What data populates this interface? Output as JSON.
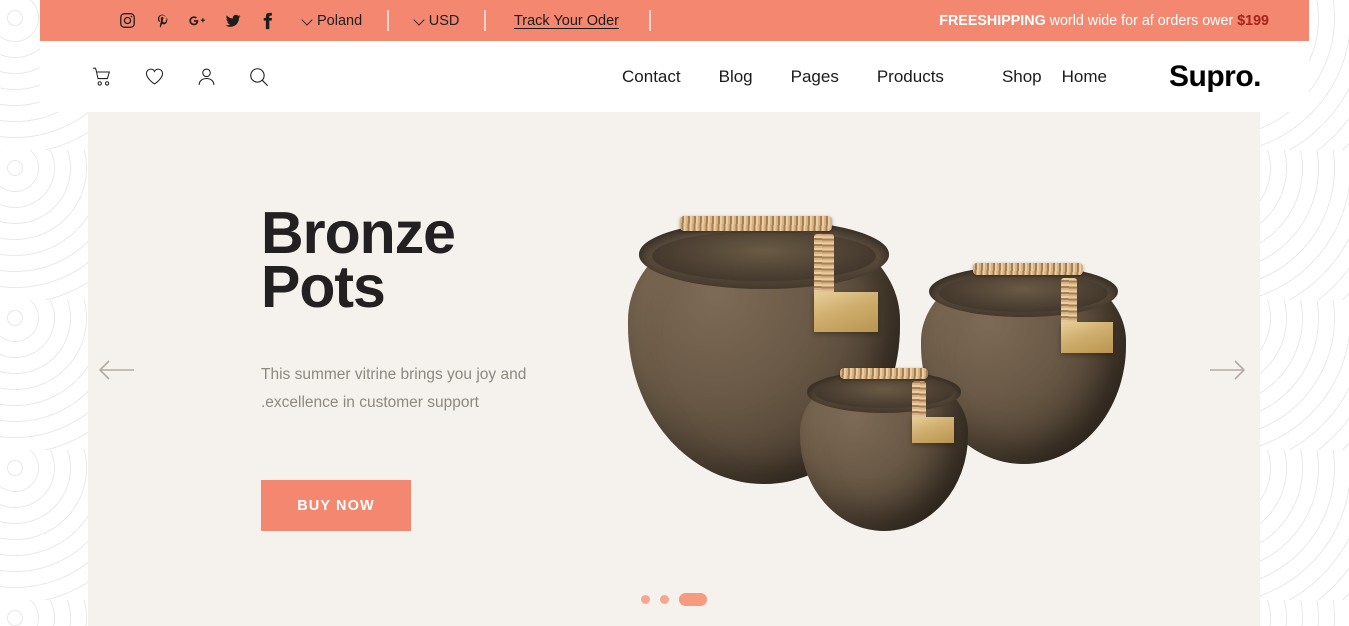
{
  "topbar": {
    "social": [
      {
        "name": "instagram-icon",
        "label": "Instagram"
      },
      {
        "name": "pinterest-icon",
        "label": "Pinterest"
      },
      {
        "name": "google-plus-icon",
        "label": "Google Plus"
      },
      {
        "name": "twitter-icon",
        "label": "Twitter"
      },
      {
        "name": "facebook-icon",
        "label": "Facebook"
      }
    ],
    "country": "Poland",
    "currency": "USD",
    "track_order": "Track Your Oder",
    "promo_prefix": "FREESHIPPING",
    "promo_text": " world wide for af orders ower ",
    "promo_price": "$199",
    "bg_color": "#F4876F",
    "promo_price_color": "#A5251A"
  },
  "header": {
    "icons": [
      {
        "name": "cart-icon",
        "label": "Cart"
      },
      {
        "name": "heart-icon",
        "label": "Wishlist"
      },
      {
        "name": "user-icon",
        "label": "Account"
      },
      {
        "name": "search-icon",
        "label": "Search"
      }
    ],
    "nav": [
      {
        "label": "Contact"
      },
      {
        "label": "Blog"
      },
      {
        "label": "Pages"
      },
      {
        "label": "Products"
      },
      {
        "label": "Shop"
      },
      {
        "label": "Home"
      }
    ],
    "brand": "Supro."
  },
  "hero": {
    "title_line1": "Bronze",
    "title_line2": "Pots",
    "subtitle_line1": "This summer vitrine brings you joy and",
    "subtitle_line2": ".excellence in customer support",
    "cta": "BUY NOW",
    "bg_color": "#F5F1EC",
    "accent_color": "#F4876F",
    "slides": [
      {
        "active": false
      },
      {
        "active": false
      },
      {
        "active": true
      }
    ],
    "prev_label": "Previous slide",
    "next_label": "Next slide",
    "product_alt": "Three bronze pots with rattan handles"
  }
}
